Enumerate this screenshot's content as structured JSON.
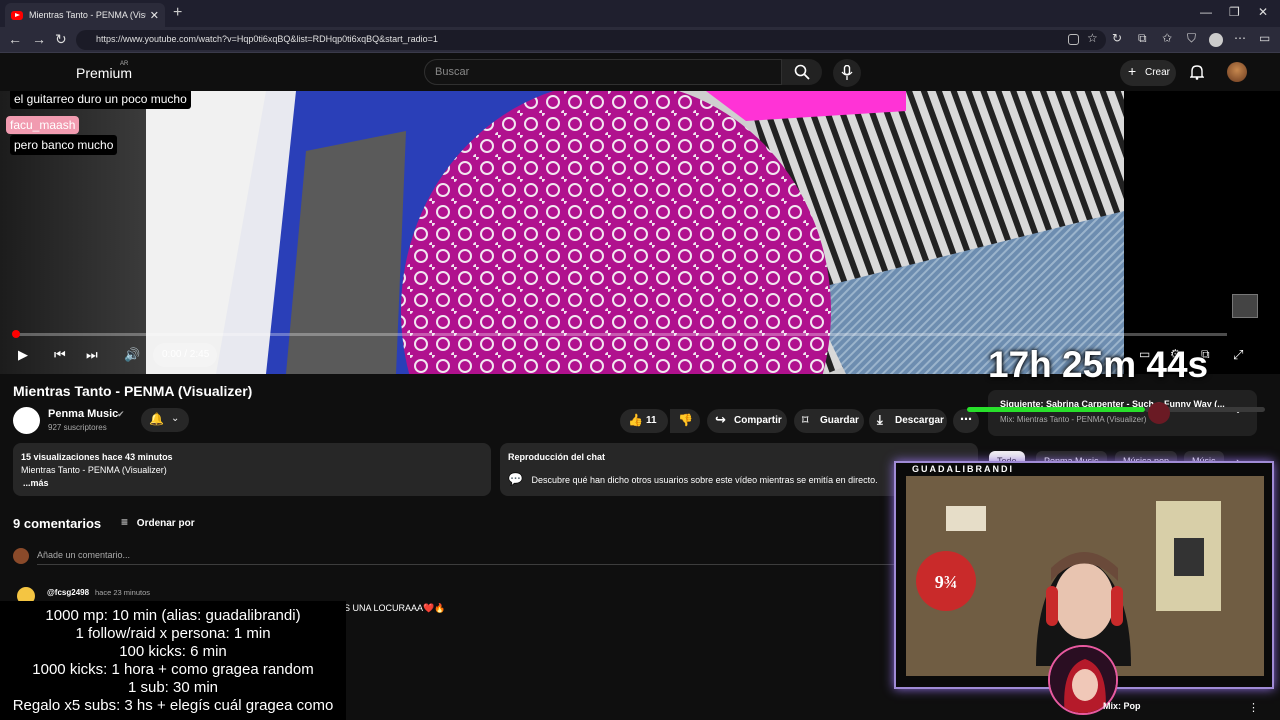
{
  "browser": {
    "tab_title": "Mientras Tanto - PENMA (Visualizer)",
    "url": "https://www.youtube.com/watch?v=Hqp0ti6xqBQ&list=RDHqp0ti6xqBQ&start_radio=1"
  },
  "youtube": {
    "logo_text": "Premium",
    "logo_region": "AR",
    "search_placeholder": "Buscar",
    "create_label": "Crear"
  },
  "player": {
    "time": "0:00 / 2:45",
    "progress_fraction": 0.0
  },
  "stream_overlay": {
    "timer": "17h 25m 44s",
    "cam_label": "GUADALIBRANDI",
    "chat": [
      {
        "user": "facu_maash",
        "message": "el guitarreo duro un poco mucho"
      },
      {
        "user": "facu_maash",
        "message": "pero banco mucho"
      }
    ],
    "goals": [
      "1000 mp: 10 min (alias: guadalibrandi)",
      "1 follow/raid x persona: 1 min",
      "100 kicks: 6 min",
      "1000 kicks: 1 hora + como gragea random",
      "1 sub: 30 min",
      "Regalo x5 subs: 3 hs + elegís cuál gragea como"
    ]
  },
  "video": {
    "title": "Mientras Tanto - PENMA (Visualizer)",
    "channel": "Penma Music",
    "subscribers": "927 suscriptores",
    "likes": "11",
    "share_label": "Compartir",
    "save_label": "Guardar",
    "download_label": "Descargar"
  },
  "description": {
    "stats": "15 visualizaciones  hace 43 minutos",
    "text": "Mientras Tanto - PENMA (Visualizer)",
    "more": "...más"
  },
  "chat_replay": {
    "title": "Reproducción del chat",
    "text": "Descubre qué han dicho otros usuarios sobre este vídeo mientras se emitía en directo."
  },
  "comments": {
    "count": "9 comentarios",
    "sort_label": "Ordenar por",
    "add_placeholder": "Añade un comentario...",
    "items": [
      {
        "user": "@fcsg2498",
        "time": "hace 23 minutos",
        "text": "S UNA LOCURAAA❤️🔥"
      }
    ]
  },
  "next_up": {
    "title": "Siguiente: Sabrina Carpenter - Such a Funny Way (...",
    "subtitle": "Mix: Mientras Tanto - PENMA (Visualizer)"
  },
  "chips": [
    "Todo",
    "Penma Music",
    "Música pop",
    "Músic"
  ],
  "bottom_chip": "Mix: Pop",
  "colors": {
    "accent": "#ff0000",
    "chat_name_bg": "#f19bb0",
    "timer_bar": "#28e02b",
    "cam_border": "#a08bd6"
  }
}
